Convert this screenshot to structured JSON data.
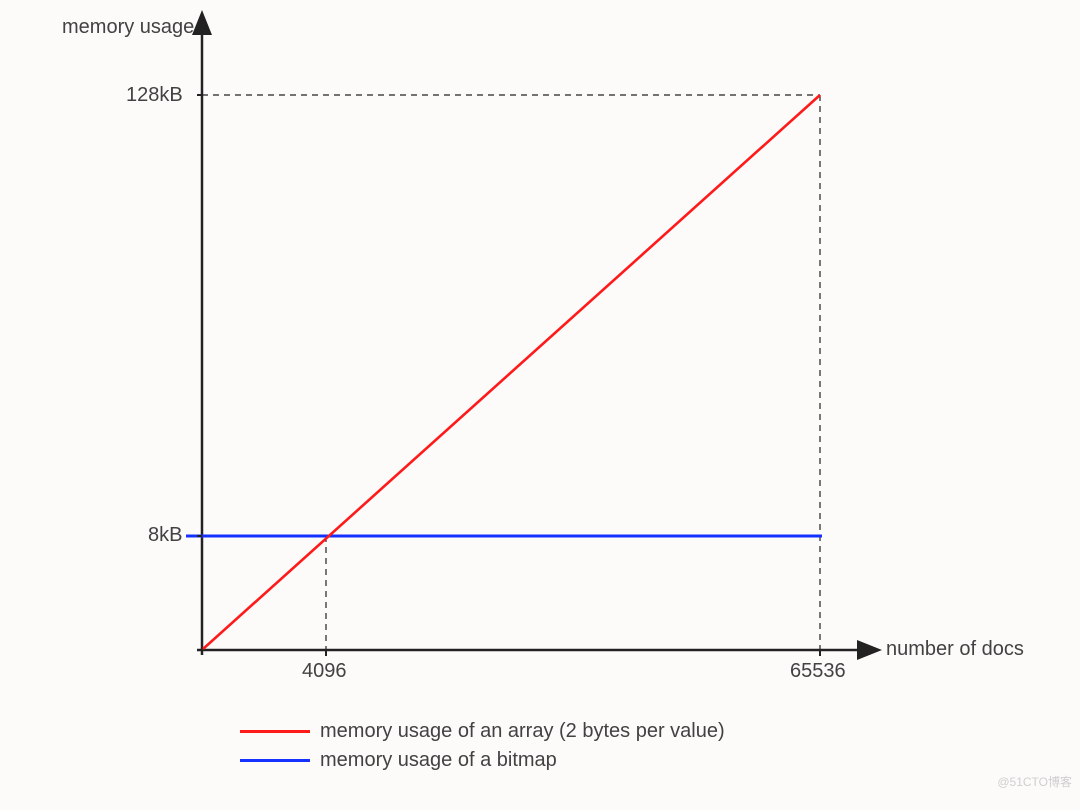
{
  "chart_data": {
    "type": "line",
    "title": "",
    "xlabel": "number of docs",
    "ylabel": "memory usage",
    "x": [
      0,
      4096,
      65536
    ],
    "xlim": [
      0,
      65536
    ],
    "ylim": [
      0,
      131072
    ],
    "x_ticks_labeled": [
      4096,
      65536
    ],
    "y_ticks_labeled": [
      "8kB",
      "128kB"
    ],
    "series": [
      {
        "name": "memory usage of an array (2 bytes per value)",
        "color": "#ff1a1a",
        "x": [
          0,
          4096,
          65536
        ],
        "y": [
          0,
          8192,
          131072
        ]
      },
      {
        "name": "memory usage of a bitmap",
        "color": "#1531ff",
        "x": [
          0,
          4096,
          65536
        ],
        "y": [
          8192,
          8192,
          8192
        ]
      }
    ],
    "intersection": {
      "x": 4096,
      "y": 8192,
      "label": "8kB"
    },
    "annotations": {
      "dashed_guides": [
        {
          "from": "y=128kB",
          "to": "x=65536"
        },
        {
          "from": "x=4096",
          "to": "origin"
        },
        {
          "from": "x=65536",
          "to": "origin"
        }
      ]
    }
  },
  "labels": {
    "ylabel": "memory usage",
    "xlabel": "number of docs",
    "y_tick_128": "128kB",
    "y_tick_8": "8kB",
    "x_tick_4096": "4096",
    "x_tick_65536": "65536"
  },
  "legend": {
    "items": [
      {
        "label": "memory usage of an array (2 bytes per value)"
      },
      {
        "label": "memory usage of a bitmap"
      }
    ]
  },
  "watermark": "@51CTO博客"
}
